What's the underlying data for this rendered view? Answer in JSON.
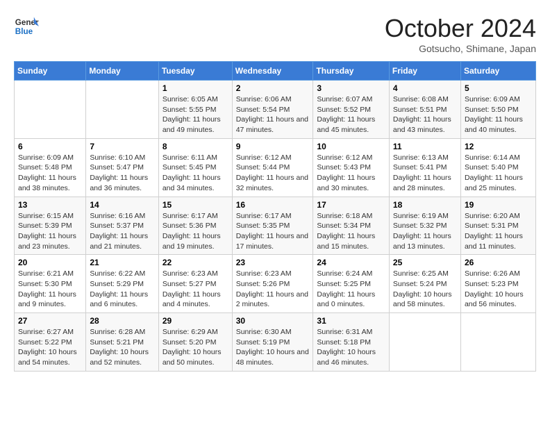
{
  "logo": {
    "line1": "General",
    "line2": "Blue"
  },
  "title": "October 2024",
  "location": "Gotsucho, Shimane, Japan",
  "days_of_week": [
    "Sunday",
    "Monday",
    "Tuesday",
    "Wednesday",
    "Thursday",
    "Friday",
    "Saturday"
  ],
  "weeks": [
    [
      {
        "day": "",
        "info": ""
      },
      {
        "day": "",
        "info": ""
      },
      {
        "day": "1",
        "info": "Sunrise: 6:05 AM\nSunset: 5:55 PM\nDaylight: 11 hours and 49 minutes."
      },
      {
        "day": "2",
        "info": "Sunrise: 6:06 AM\nSunset: 5:54 PM\nDaylight: 11 hours and 47 minutes."
      },
      {
        "day": "3",
        "info": "Sunrise: 6:07 AM\nSunset: 5:52 PM\nDaylight: 11 hours and 45 minutes."
      },
      {
        "day": "4",
        "info": "Sunrise: 6:08 AM\nSunset: 5:51 PM\nDaylight: 11 hours and 43 minutes."
      },
      {
        "day": "5",
        "info": "Sunrise: 6:09 AM\nSunset: 5:50 PM\nDaylight: 11 hours and 40 minutes."
      }
    ],
    [
      {
        "day": "6",
        "info": "Sunrise: 6:09 AM\nSunset: 5:48 PM\nDaylight: 11 hours and 38 minutes."
      },
      {
        "day": "7",
        "info": "Sunrise: 6:10 AM\nSunset: 5:47 PM\nDaylight: 11 hours and 36 minutes."
      },
      {
        "day": "8",
        "info": "Sunrise: 6:11 AM\nSunset: 5:45 PM\nDaylight: 11 hours and 34 minutes."
      },
      {
        "day": "9",
        "info": "Sunrise: 6:12 AM\nSunset: 5:44 PM\nDaylight: 11 hours and 32 minutes."
      },
      {
        "day": "10",
        "info": "Sunrise: 6:12 AM\nSunset: 5:43 PM\nDaylight: 11 hours and 30 minutes."
      },
      {
        "day": "11",
        "info": "Sunrise: 6:13 AM\nSunset: 5:41 PM\nDaylight: 11 hours and 28 minutes."
      },
      {
        "day": "12",
        "info": "Sunrise: 6:14 AM\nSunset: 5:40 PM\nDaylight: 11 hours and 25 minutes."
      }
    ],
    [
      {
        "day": "13",
        "info": "Sunrise: 6:15 AM\nSunset: 5:39 PM\nDaylight: 11 hours and 23 minutes."
      },
      {
        "day": "14",
        "info": "Sunrise: 6:16 AM\nSunset: 5:37 PM\nDaylight: 11 hours and 21 minutes."
      },
      {
        "day": "15",
        "info": "Sunrise: 6:17 AM\nSunset: 5:36 PM\nDaylight: 11 hours and 19 minutes."
      },
      {
        "day": "16",
        "info": "Sunrise: 6:17 AM\nSunset: 5:35 PM\nDaylight: 11 hours and 17 minutes."
      },
      {
        "day": "17",
        "info": "Sunrise: 6:18 AM\nSunset: 5:34 PM\nDaylight: 11 hours and 15 minutes."
      },
      {
        "day": "18",
        "info": "Sunrise: 6:19 AM\nSunset: 5:32 PM\nDaylight: 11 hours and 13 minutes."
      },
      {
        "day": "19",
        "info": "Sunrise: 6:20 AM\nSunset: 5:31 PM\nDaylight: 11 hours and 11 minutes."
      }
    ],
    [
      {
        "day": "20",
        "info": "Sunrise: 6:21 AM\nSunset: 5:30 PM\nDaylight: 11 hours and 9 minutes."
      },
      {
        "day": "21",
        "info": "Sunrise: 6:22 AM\nSunset: 5:29 PM\nDaylight: 11 hours and 6 minutes."
      },
      {
        "day": "22",
        "info": "Sunrise: 6:23 AM\nSunset: 5:27 PM\nDaylight: 11 hours and 4 minutes."
      },
      {
        "day": "23",
        "info": "Sunrise: 6:23 AM\nSunset: 5:26 PM\nDaylight: 11 hours and 2 minutes."
      },
      {
        "day": "24",
        "info": "Sunrise: 6:24 AM\nSunset: 5:25 PM\nDaylight: 11 hours and 0 minutes."
      },
      {
        "day": "25",
        "info": "Sunrise: 6:25 AM\nSunset: 5:24 PM\nDaylight: 10 hours and 58 minutes."
      },
      {
        "day": "26",
        "info": "Sunrise: 6:26 AM\nSunset: 5:23 PM\nDaylight: 10 hours and 56 minutes."
      }
    ],
    [
      {
        "day": "27",
        "info": "Sunrise: 6:27 AM\nSunset: 5:22 PM\nDaylight: 10 hours and 54 minutes."
      },
      {
        "day": "28",
        "info": "Sunrise: 6:28 AM\nSunset: 5:21 PM\nDaylight: 10 hours and 52 minutes."
      },
      {
        "day": "29",
        "info": "Sunrise: 6:29 AM\nSunset: 5:20 PM\nDaylight: 10 hours and 50 minutes."
      },
      {
        "day": "30",
        "info": "Sunrise: 6:30 AM\nSunset: 5:19 PM\nDaylight: 10 hours and 48 minutes."
      },
      {
        "day": "31",
        "info": "Sunrise: 6:31 AM\nSunset: 5:18 PM\nDaylight: 10 hours and 46 minutes."
      },
      {
        "day": "",
        "info": ""
      },
      {
        "day": "",
        "info": ""
      }
    ]
  ]
}
